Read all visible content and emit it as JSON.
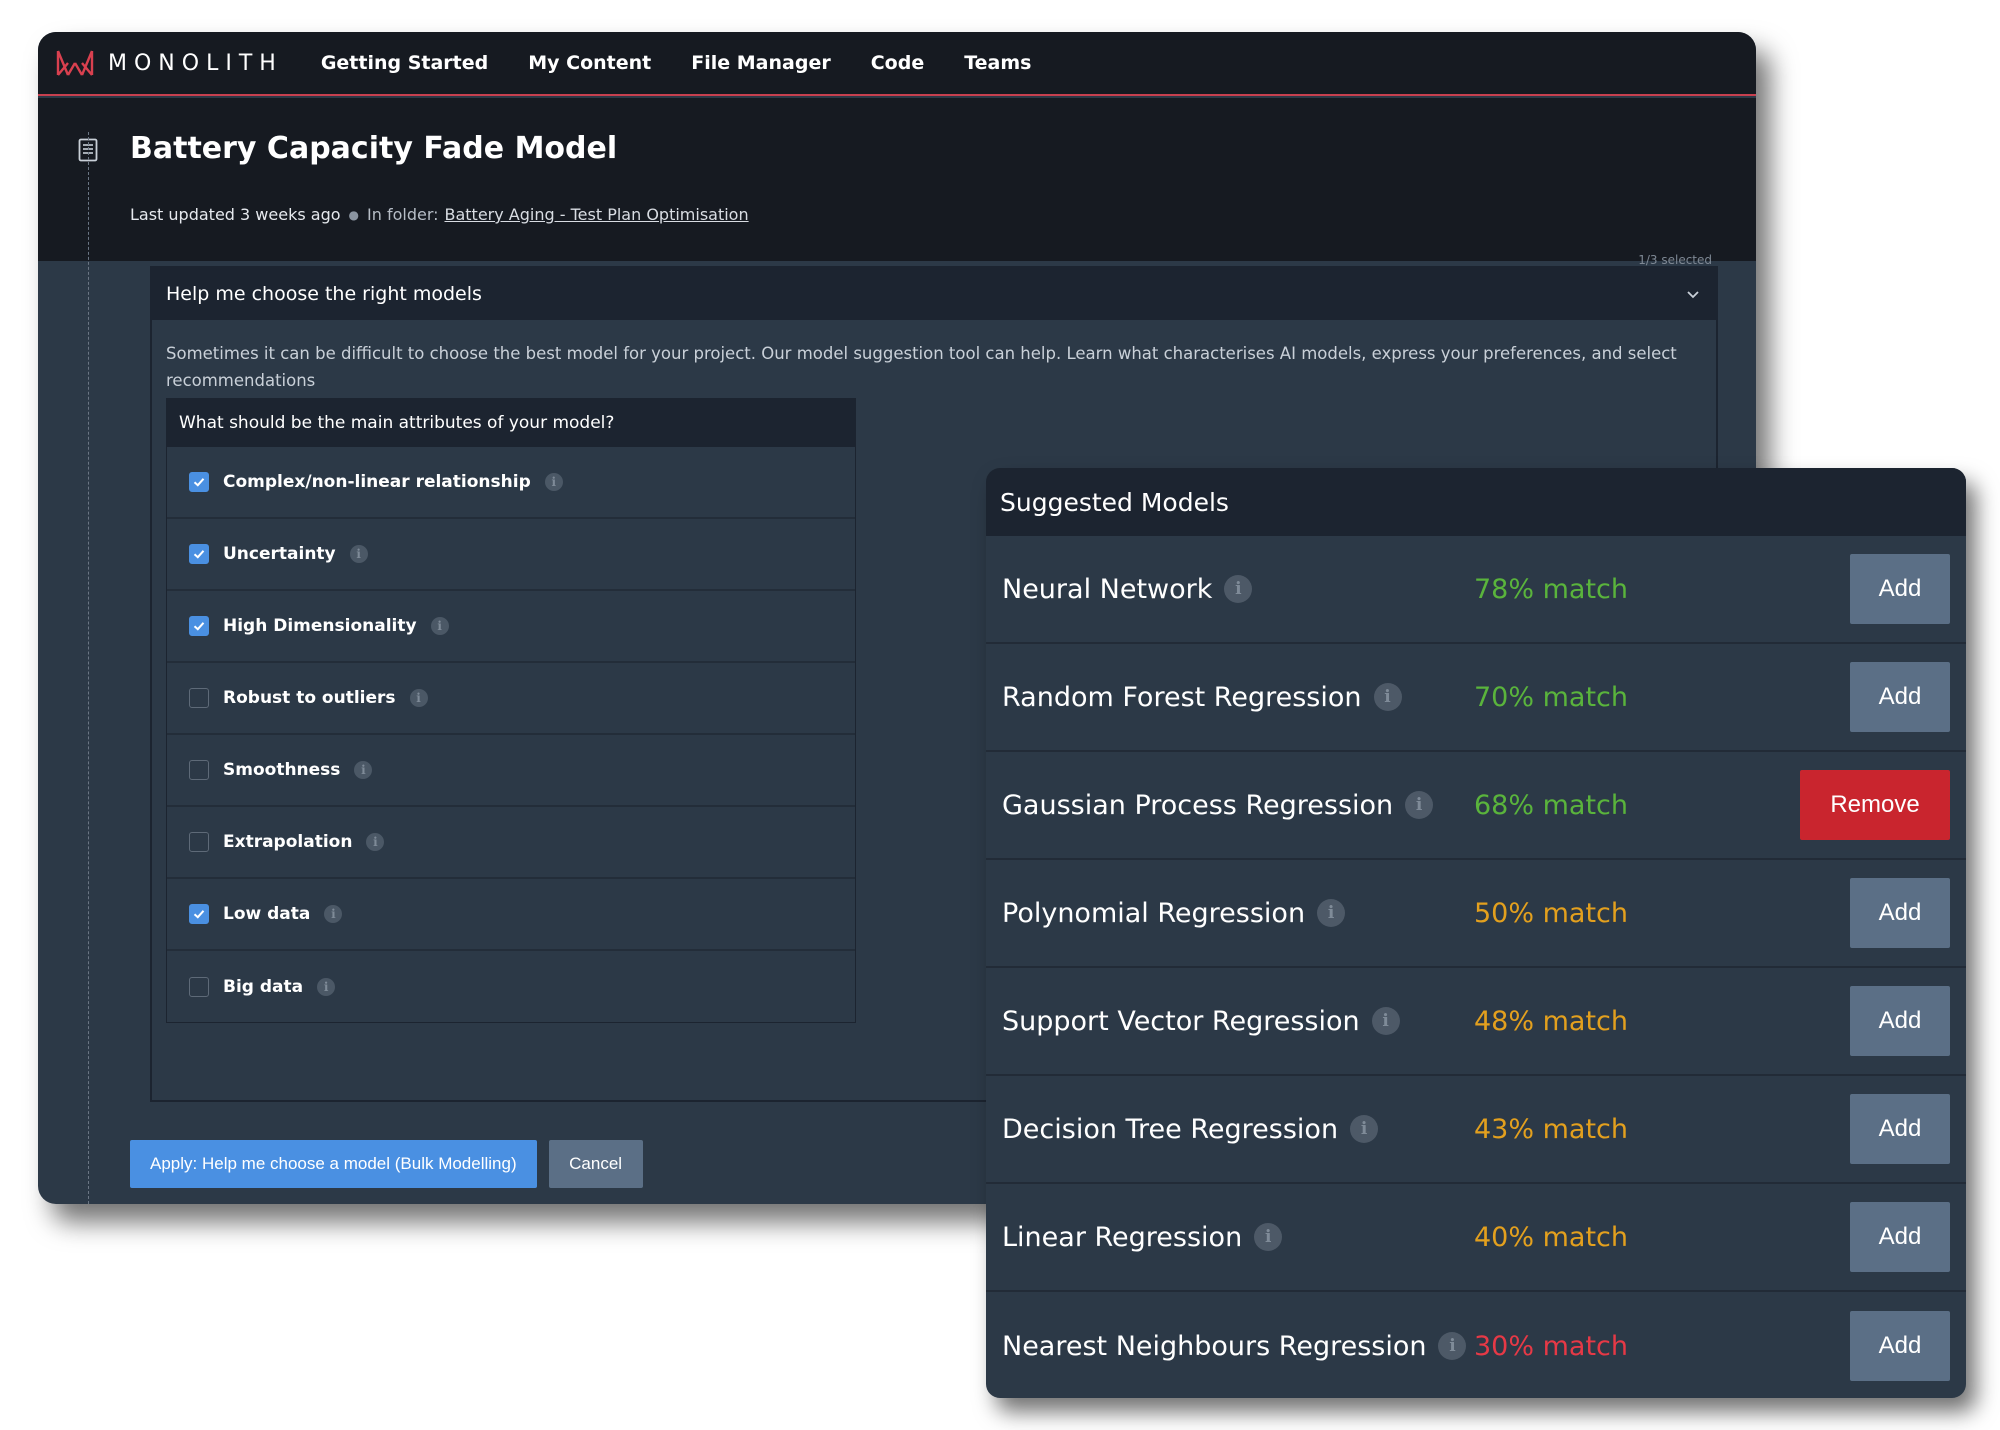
{
  "nav": {
    "brand": "MONOLITH",
    "items": [
      "Getting Started",
      "My Content",
      "File Manager",
      "Code",
      "Teams"
    ]
  },
  "header": {
    "title": "Battery Capacity Fade Model",
    "updated": "Last updated 3 weeks ago",
    "folder_prefix": "In folder:",
    "folder_name": "Battery Aging - Test Plan Optimisation",
    "selected_count": "1/3 selected"
  },
  "accordion": {
    "title": "Help me choose the right models",
    "description": "Sometimes it can be difficult to choose the best model for your project. Our model suggestion tool can help. Learn what characterises AI models, express your preferences, and select recommendations",
    "attributes_question": "What should be the main attributes of your model?",
    "attributes": [
      {
        "label": "Complex/non-linear relationship",
        "checked": true
      },
      {
        "label": "Uncertainty",
        "checked": true
      },
      {
        "label": "High Dimensionality",
        "checked": true
      },
      {
        "label": "Robust to outliers",
        "checked": false
      },
      {
        "label": "Smoothness",
        "checked": false
      },
      {
        "label": "Extrapolation",
        "checked": false
      },
      {
        "label": "Low data",
        "checked": true
      },
      {
        "label": "Big data",
        "checked": false
      }
    ]
  },
  "actions": {
    "apply_label": "Apply: Help me choose a model (Bulk Modelling)",
    "cancel_label": "Cancel"
  },
  "suggested": {
    "title": "Suggested Models",
    "models": [
      {
        "name": "Neural Network",
        "match": "78% match",
        "action": "Add",
        "match_color": "#5ab43c"
      },
      {
        "name": "Random Forest Regression",
        "match": "70% match",
        "action": "Add",
        "match_color": "#5ab43c"
      },
      {
        "name": "Gaussian Process Regression",
        "match": "68% match",
        "action": "Remove",
        "match_color": "#5ab43c"
      },
      {
        "name": "Polynomial Regression",
        "match": "50% match",
        "action": "Add",
        "match_color": "#e3a01e"
      },
      {
        "name": "Support Vector Regression",
        "match": "48% match",
        "action": "Add",
        "match_color": "#e3a01e"
      },
      {
        "name": "Decision Tree Regression",
        "match": "43% match",
        "action": "Add",
        "match_color": "#e3a01e"
      },
      {
        "name": "Linear Regression",
        "match": "40% match",
        "action": "Add",
        "match_color": "#e3a01e"
      },
      {
        "name": "Nearest Neighbours Regression",
        "match": "30% match",
        "action": "Add",
        "match_color": "#e63946"
      }
    ]
  },
  "icons": {
    "info": "i"
  },
  "colors": {
    "accent": "#4a90e2",
    "nav_underline": "#c7404f",
    "remove": "#c9252e"
  }
}
